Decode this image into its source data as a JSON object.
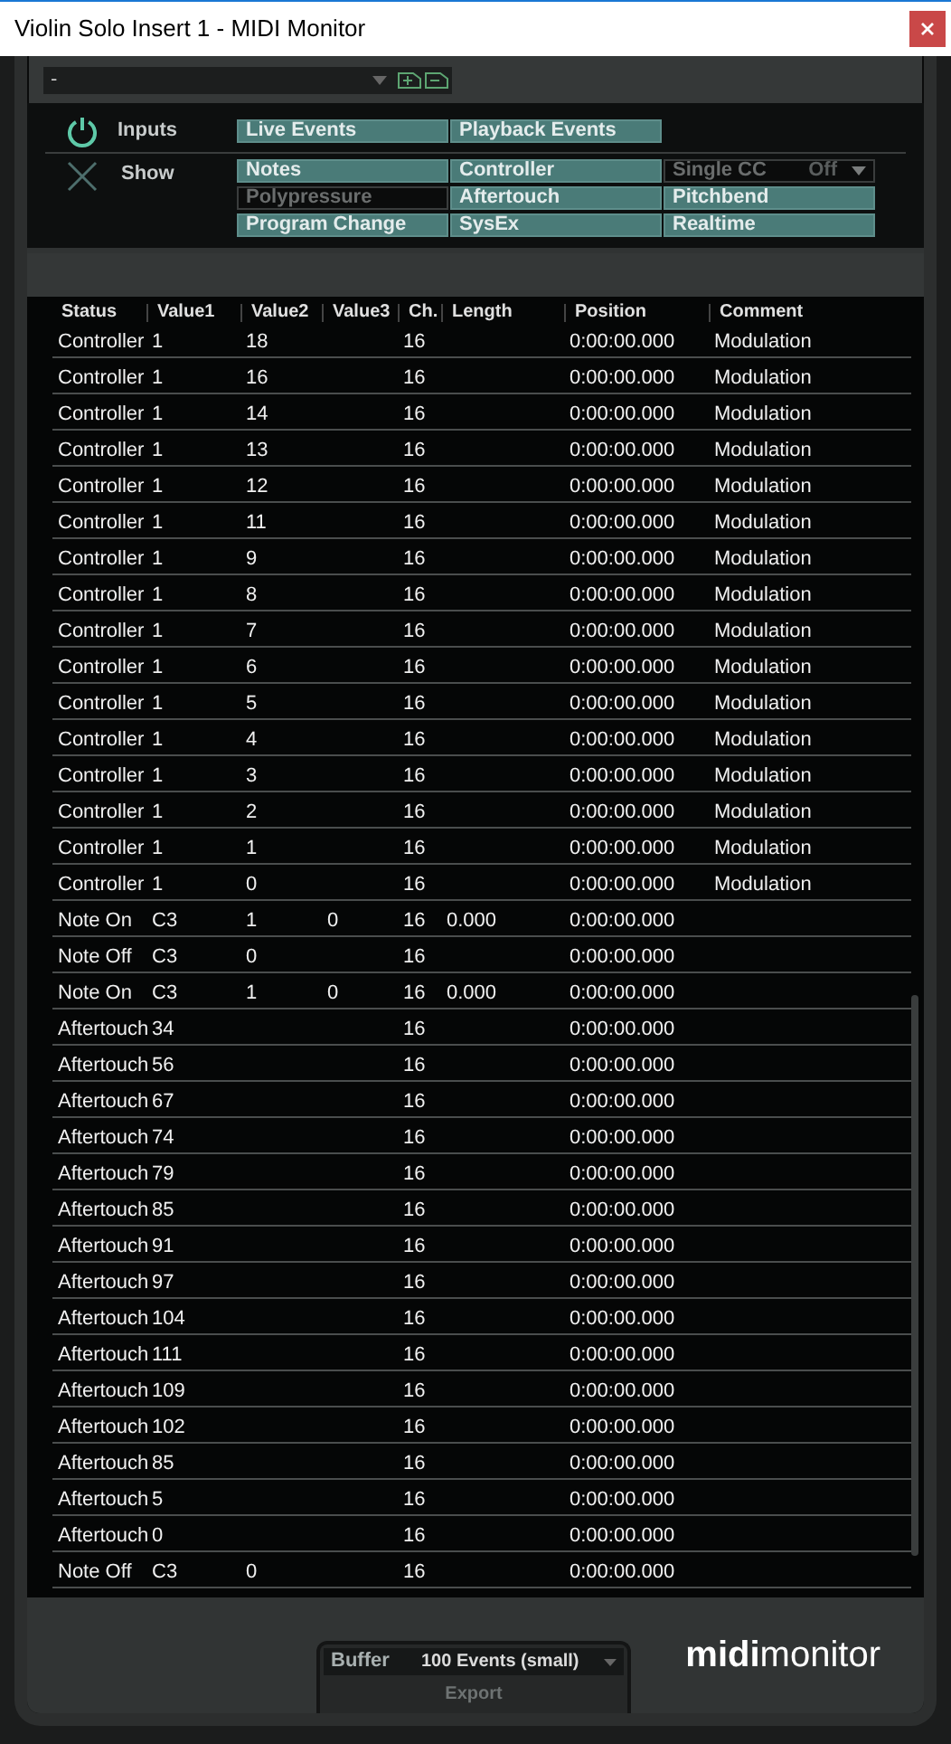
{
  "window": {
    "title": "Violin Solo Insert 1 - MIDI Monitor"
  },
  "preset": {
    "value": "-"
  },
  "inputs": {
    "label": "Inputs",
    "power_on": true,
    "buttons": [
      {
        "label": "Live Events",
        "on": true
      },
      {
        "label": "Playback Events",
        "on": true
      }
    ]
  },
  "show": {
    "label": "Show",
    "buttons": [
      {
        "label": "Notes",
        "on": true,
        "kind": "toggle"
      },
      {
        "label": "Controller",
        "on": true,
        "kind": "toggle"
      },
      {
        "label": "Single CC",
        "on": false,
        "kind": "dropdown",
        "value": "Off"
      },
      {
        "label": "Polypressure",
        "on": false,
        "kind": "toggle"
      },
      {
        "label": "Aftertouch",
        "on": true,
        "kind": "toggle"
      },
      {
        "label": "Pitchbend",
        "on": true,
        "kind": "toggle"
      },
      {
        "label": "Program Change",
        "on": true,
        "kind": "toggle"
      },
      {
        "label": "SysEx",
        "on": true,
        "kind": "toggle"
      },
      {
        "label": "Realtime",
        "on": true,
        "kind": "toggle"
      }
    ]
  },
  "table": {
    "columns": [
      "Status",
      "Value1",
      "Value2",
      "Value3",
      "Ch.",
      "Length",
      "Position",
      "Comment"
    ],
    "rows": [
      [
        "Controller",
        "1",
        "18",
        "",
        "16",
        "",
        "0:00:00.000",
        "Modulation"
      ],
      [
        "Controller",
        "1",
        "16",
        "",
        "16",
        "",
        "0:00:00.000",
        "Modulation"
      ],
      [
        "Controller",
        "1",
        "14",
        "",
        "16",
        "",
        "0:00:00.000",
        "Modulation"
      ],
      [
        "Controller",
        "1",
        "13",
        "",
        "16",
        "",
        "0:00:00.000",
        "Modulation"
      ],
      [
        "Controller",
        "1",
        "12",
        "",
        "16",
        "",
        "0:00:00.000",
        "Modulation"
      ],
      [
        "Controller",
        "1",
        "11",
        "",
        "16",
        "",
        "0:00:00.000",
        "Modulation"
      ],
      [
        "Controller",
        "1",
        "9",
        "",
        "16",
        "",
        "0:00:00.000",
        "Modulation"
      ],
      [
        "Controller",
        "1",
        "8",
        "",
        "16",
        "",
        "0:00:00.000",
        "Modulation"
      ],
      [
        "Controller",
        "1",
        "7",
        "",
        "16",
        "",
        "0:00:00.000",
        "Modulation"
      ],
      [
        "Controller",
        "1",
        "6",
        "",
        "16",
        "",
        "0:00:00.000",
        "Modulation"
      ],
      [
        "Controller",
        "1",
        "5",
        "",
        "16",
        "",
        "0:00:00.000",
        "Modulation"
      ],
      [
        "Controller",
        "1",
        "4",
        "",
        "16",
        "",
        "0:00:00.000",
        "Modulation"
      ],
      [
        "Controller",
        "1",
        "3",
        "",
        "16",
        "",
        "0:00:00.000",
        "Modulation"
      ],
      [
        "Controller",
        "1",
        "2",
        "",
        "16",
        "",
        "0:00:00.000",
        "Modulation"
      ],
      [
        "Controller",
        "1",
        "1",
        "",
        "16",
        "",
        "0:00:00.000",
        "Modulation"
      ],
      [
        "Controller",
        "1",
        "0",
        "",
        "16",
        "",
        "0:00:00.000",
        "Modulation"
      ],
      [
        "Note On",
        "C3",
        "1",
        "0",
        "16",
        "0.000",
        "0:00:00.000",
        ""
      ],
      [
        "Note Off",
        "C3",
        "0",
        "",
        "16",
        "",
        "0:00:00.000",
        ""
      ],
      [
        "Note On",
        "C3",
        "1",
        "0",
        "16",
        "0.000",
        "0:00:00.000",
        ""
      ],
      [
        "Aftertouch",
        "34",
        "",
        "",
        "16",
        "",
        "0:00:00.000",
        ""
      ],
      [
        "Aftertouch",
        "56",
        "",
        "",
        "16",
        "",
        "0:00:00.000",
        ""
      ],
      [
        "Aftertouch",
        "67",
        "",
        "",
        "16",
        "",
        "0:00:00.000",
        ""
      ],
      [
        "Aftertouch",
        "74",
        "",
        "",
        "16",
        "",
        "0:00:00.000",
        ""
      ],
      [
        "Aftertouch",
        "79",
        "",
        "",
        "16",
        "",
        "0:00:00.000",
        ""
      ],
      [
        "Aftertouch",
        "85",
        "",
        "",
        "16",
        "",
        "0:00:00.000",
        ""
      ],
      [
        "Aftertouch",
        "91",
        "",
        "",
        "16",
        "",
        "0:00:00.000",
        ""
      ],
      [
        "Aftertouch",
        "97",
        "",
        "",
        "16",
        "",
        "0:00:00.000",
        ""
      ],
      [
        "Aftertouch",
        "104",
        "",
        "",
        "16",
        "",
        "0:00:00.000",
        ""
      ],
      [
        "Aftertouch",
        "111",
        "",
        "",
        "16",
        "",
        "0:00:00.000",
        ""
      ],
      [
        "Aftertouch",
        "109",
        "",
        "",
        "16",
        "",
        "0:00:00.000",
        ""
      ],
      [
        "Aftertouch",
        "102",
        "",
        "",
        "16",
        "",
        "0:00:00.000",
        ""
      ],
      [
        "Aftertouch",
        "85",
        "",
        "",
        "16",
        "",
        "0:00:00.000",
        ""
      ],
      [
        "Aftertouch",
        "5",
        "",
        "",
        "16",
        "",
        "0:00:00.000",
        ""
      ],
      [
        "Aftertouch",
        "0",
        "",
        "",
        "16",
        "",
        "0:00:00.000",
        ""
      ],
      [
        "Note Off",
        "C3",
        "0",
        "",
        "16",
        "",
        "0:00:00.000",
        ""
      ]
    ]
  },
  "footer": {
    "buffer_label": "Buffer",
    "buffer_value": "100 Events (small)",
    "export": "Export",
    "logo_bold": "midi",
    "logo_light": "monitor"
  }
}
